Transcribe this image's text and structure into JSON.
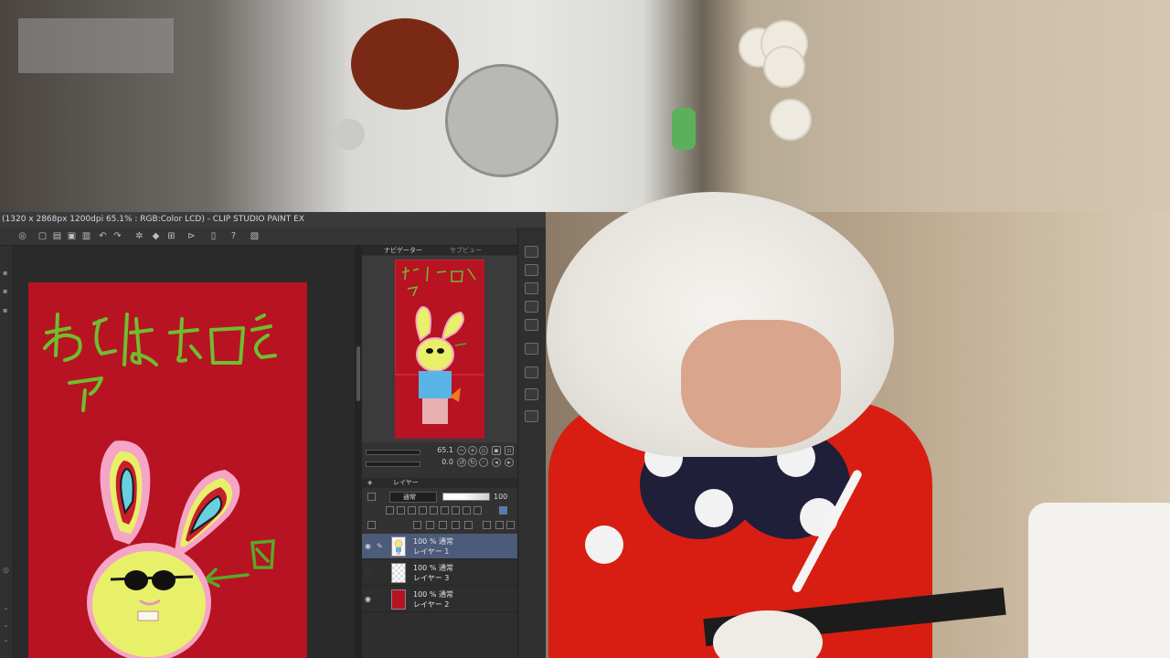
{
  "window": {
    "title": "(1320 x 2868px 1200dpi 65.1% : RGB:Color LCD) - CLIP STUDIO PAINT EX"
  },
  "toolbar": {
    "icons": [
      "menu-icon",
      "new-icon",
      "open-icon",
      "save-icon",
      "undo-icon",
      "redo-icon",
      "settings-icon",
      "fill-icon",
      "transform-icon",
      "play-icon",
      "page-icon",
      "help-icon",
      "image-icon"
    ]
  },
  "navigator": {
    "tab_navigator": "ナビゲーター",
    "tab_sub": "サブビュー",
    "zoom": "65.1",
    "rotation": "0.0"
  },
  "layers": {
    "tab": "レイヤー",
    "blend_mode": "通常",
    "opacity": "100",
    "items": [
      {
        "meta": "100 % 通常",
        "name": "レイヤー 1",
        "selected": true,
        "visible": true,
        "thumb": "rabbit"
      },
      {
        "meta": "100 % 通常",
        "name": "レイヤー 3",
        "selected": false,
        "visible": false,
        "thumb": "transparent"
      },
      {
        "meta": "100 % 通常",
        "name": "レイヤー 2",
        "selected": false,
        "visible": true,
        "thumb": "red"
      }
    ]
  },
  "canvas": {
    "background_color": "#b71323",
    "handwritten_text_line1": "あとはお口を",
    "handwritten_text_line2": "ア"
  },
  "colors": {
    "canvas_red": "#b71323",
    "drawing_green": "#6fbe2e",
    "rabbit_yellow": "#e8f06a",
    "selection_blue": "#4c5b7a"
  }
}
